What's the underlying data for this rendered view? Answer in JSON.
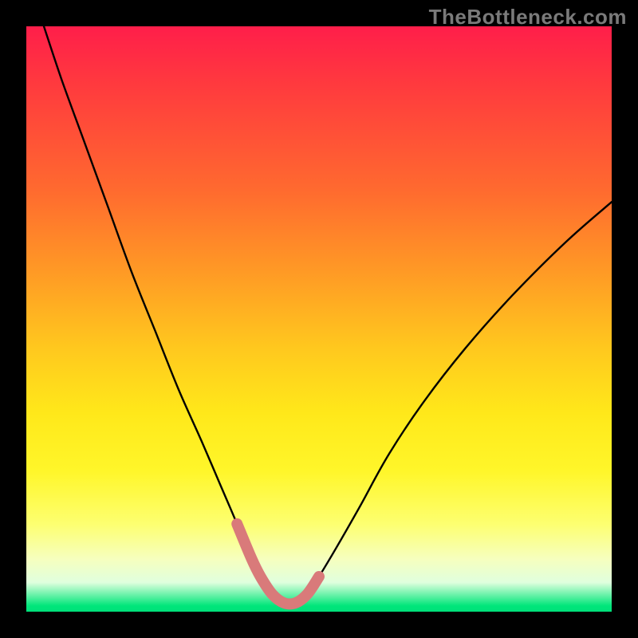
{
  "watermark": "TheBottleneck.com",
  "chart_data": {
    "type": "line",
    "title": "",
    "xlabel": "",
    "ylabel": "",
    "xlim": [
      0,
      100
    ],
    "ylim": [
      0,
      100
    ],
    "grid": false,
    "series": [
      {
        "name": "main-curve",
        "color": "#000000",
        "x": [
          3,
          6,
          10,
          14,
          18,
          22,
          26,
          30,
          33,
          36,
          38.5,
          40,
          42,
          44,
          46,
          48,
          50,
          53,
          57,
          62,
          68,
          75,
          83,
          92,
          100
        ],
        "y": [
          100,
          91,
          80,
          69,
          58,
          48,
          38,
          29,
          22,
          15,
          9,
          6,
          3,
          1.5,
          1.5,
          3,
          6,
          11,
          18,
          27,
          36,
          45,
          54,
          63,
          70
        ]
      },
      {
        "name": "highlight-segment",
        "color": "#d97a7a",
        "x": [
          36,
          38.5,
          40,
          42,
          44,
          46,
          48,
          50
        ],
        "y": [
          15,
          9,
          6,
          3,
          1.5,
          1.5,
          3,
          6
        ]
      }
    ],
    "notes": "Axes are unlabeled; values are visual estimates on a 0–100 scale in both directions. The green band occupies roughly y ∈ [0, 3]."
  }
}
